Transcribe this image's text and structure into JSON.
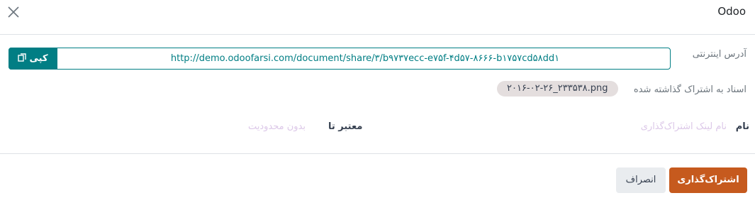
{
  "dialog": {
    "title": "Odoo",
    "close_icon": "close-icon"
  },
  "share_form": {
    "url_label": "آدرس اینترنتی",
    "url_value": "http://demo.odoofarsi.com/document/share/۳/b۹۷۳۷ecc-e۷۵f-۴d۵۷-۸۶۶۶-b۱۷۵۷cd۵۸dd۱",
    "copy_label": "کپی",
    "copy_icon": "copy-icon",
    "docs_label": "اسناد به اشتراک گذاشته شده",
    "doc_tag": "۲۰۱۶-۰۲-۲۶_۲۳۳۵۳۸.png",
    "name_label": "نام",
    "name_placeholder": "نام لینک اشتراک‌گذاری",
    "valid_label": "معتبر تا",
    "valid_placeholder": "بدون محدودیت"
  },
  "footer": {
    "share_label": "اشتراک‌گذاری",
    "cancel_label": "انصراف"
  },
  "colors": {
    "primary": "#c65a1e",
    "teal": "#017e84",
    "tag_bg": "#e4dede",
    "placeholder": "#dcc8e8"
  }
}
